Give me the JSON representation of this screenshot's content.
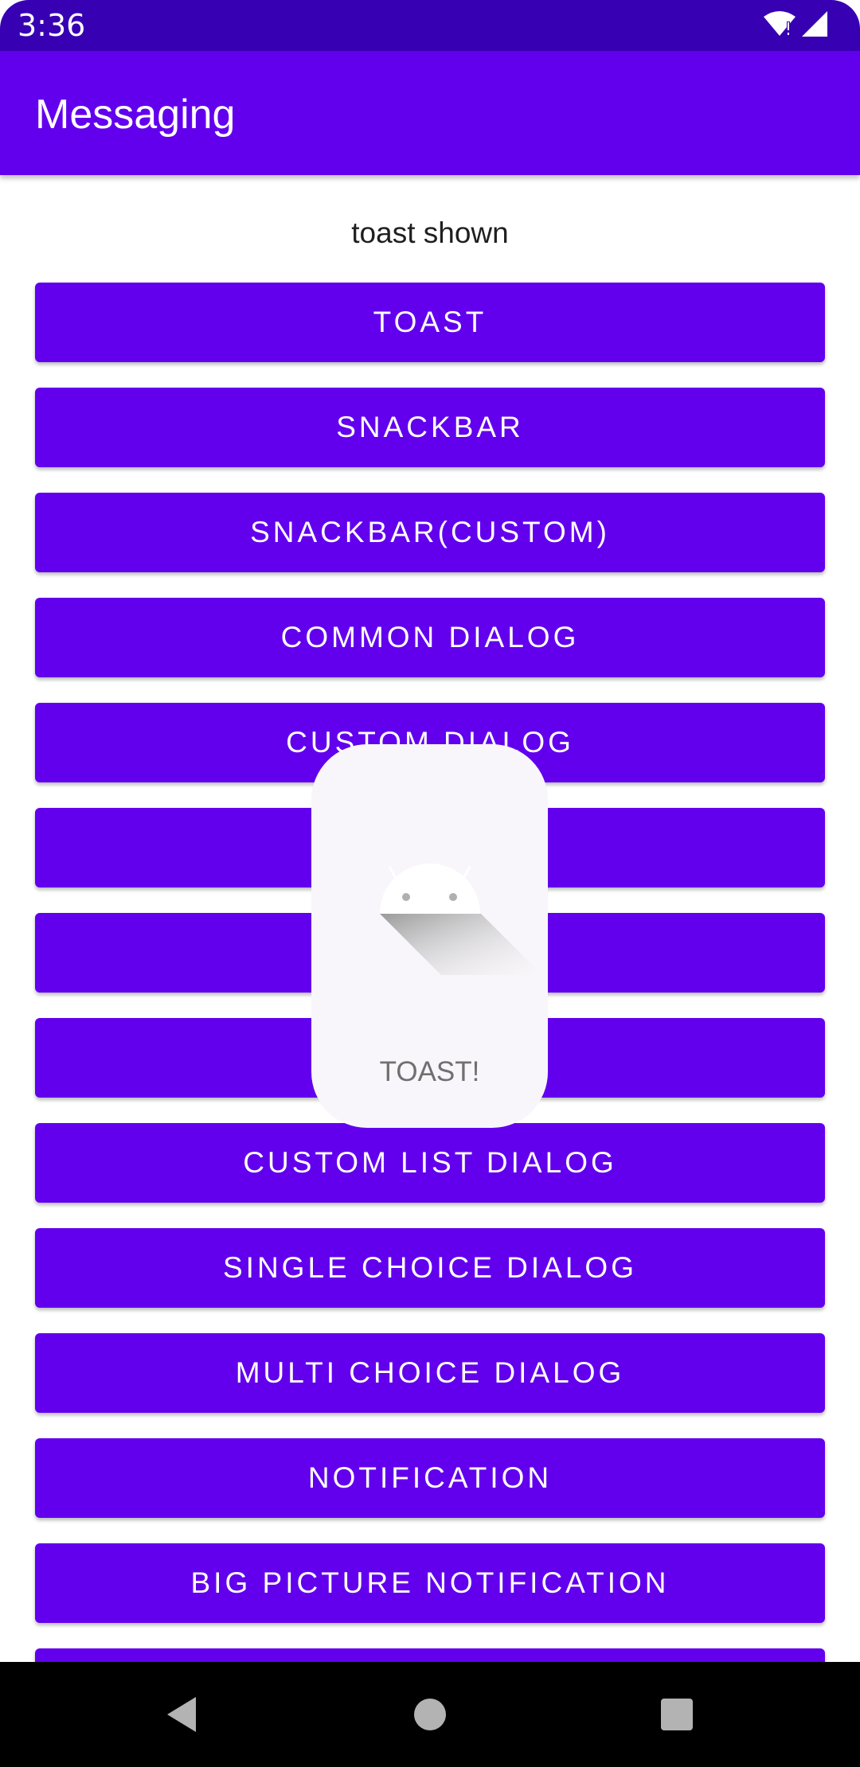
{
  "status_bar": {
    "time": "3:36",
    "icons": [
      "wifi-icon",
      "signal-icon"
    ]
  },
  "app_bar": {
    "title": "Messaging"
  },
  "status_text": "toast shown",
  "buttons": [
    {
      "label": "TOAST"
    },
    {
      "label": "SNACKBAR"
    },
    {
      "label": "SNACKBAR(CUSTOM)"
    },
    {
      "label": "COMMON DIALOG"
    },
    {
      "label": "CUSTOM DIALOG"
    },
    {
      "label": ""
    },
    {
      "label": ""
    },
    {
      "label": ""
    },
    {
      "label": "CUSTOM LIST DIALOG"
    },
    {
      "label": "SINGLE CHOICE DIALOG"
    },
    {
      "label": "MULTI CHOICE DIALOG"
    },
    {
      "label": "NOTIFICATION"
    },
    {
      "label": "BIG PICTURE NOTIFICATION"
    },
    {
      "label": ""
    }
  ],
  "toast": {
    "text": "TOAST!",
    "icon": "android-icon"
  },
  "nav_bar": {
    "icons": [
      "back-icon",
      "home-icon",
      "recents-icon"
    ]
  },
  "colors": {
    "primary": "#6200ee",
    "primary_dark": "#3700b3",
    "toast_bg": "#f9f6fb",
    "toast_text": "#707070"
  }
}
